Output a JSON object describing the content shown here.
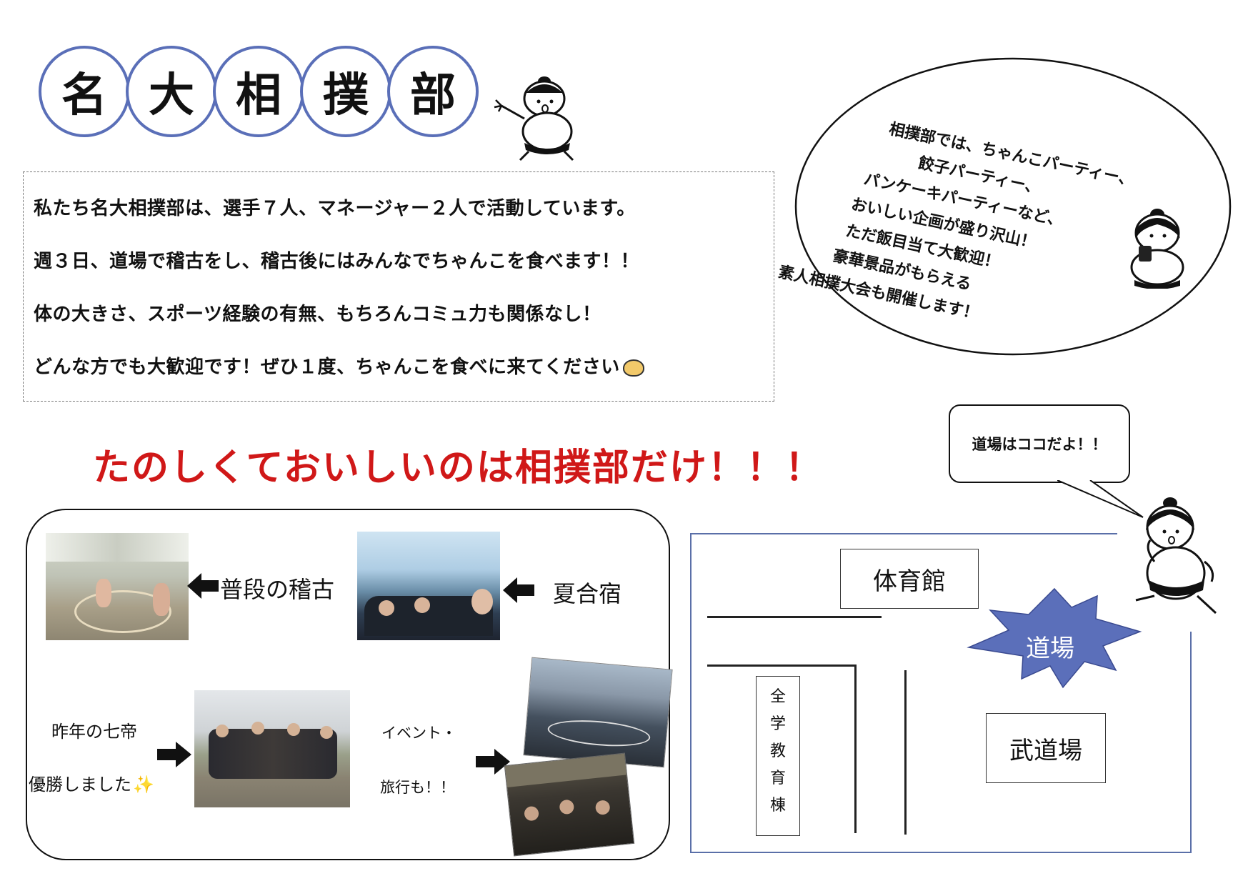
{
  "title": {
    "chars": [
      "名",
      "大",
      "相",
      "撲",
      "部"
    ]
  },
  "intro": {
    "lines": [
      "私たち名大相撲部は、選手７人、マネージャー２人で活動しています。",
      "週３日、道場で稽古をし、稽古後にはみんなでちゃんこを食べます！！",
      "体の大きさ、スポーツ経験の有無、もちろんコミュ力も関係なし！",
      "どんな方でも大歓迎です！ぜひ１度、ちゃんこを食べに来てください"
    ]
  },
  "slogan": "たのしくておいしいのは相撲部だけ！！！",
  "bubble": {
    "lines": [
      "相撲部では、ちゃんこパーティー、",
      "餃子パーティー、",
      "パンケーキパーティーなど、",
      "おいしい企画が盛り沢山！",
      "ただ飯目当て大歓迎！",
      "豪華景品がもらえる",
      "素人相撲大会も開催します！"
    ]
  },
  "map_callout": "道場はココだよ！！",
  "gallery": {
    "practice_label": "普段の稽古",
    "camp_label": "夏合宿",
    "champion_label_1": "昨年の七帝",
    "champion_label_2": "優勝しました",
    "event_label_1": "イベント・",
    "event_label_2": "旅行も！！"
  },
  "map": {
    "gym": "体育館",
    "dojo": "道場",
    "budojo": "武道場",
    "zengaku": [
      "全",
      "学",
      "教",
      "育",
      "棟"
    ]
  },
  "colors": {
    "circle_border": "#5a6fb8",
    "slogan": "#d01818",
    "dojo_star": "#5b6fba"
  }
}
